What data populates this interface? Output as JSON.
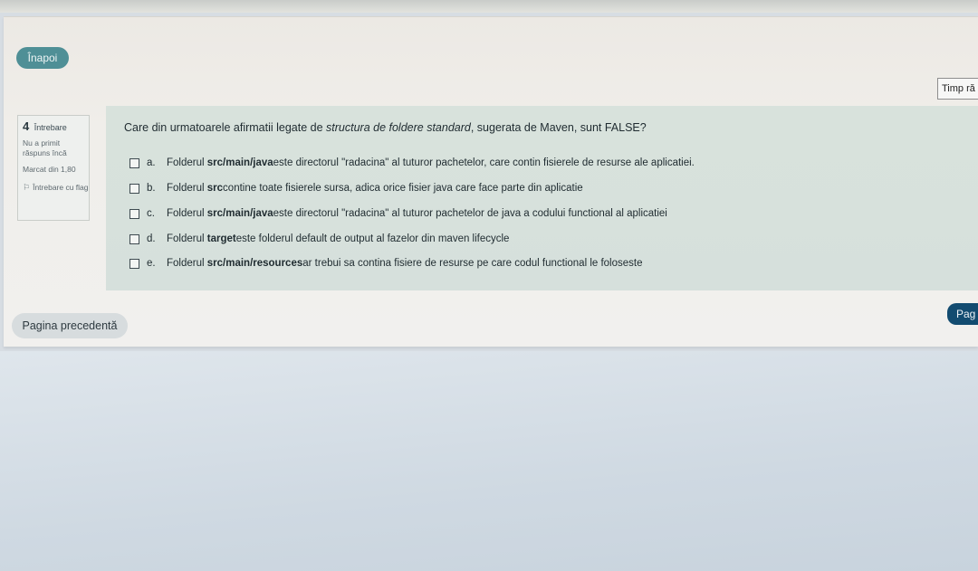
{
  "nav": {
    "back_label": "Înapoi",
    "timer_label": "Timp ră",
    "prev_label": "Pagina precedentă",
    "next_label": "Pag"
  },
  "question_info": {
    "number": "4",
    "label": "Întrebare",
    "status": "Nu a primit răspuns încă",
    "marks": "Marcat din 1,80",
    "flag_label": "Întrebare cu flag"
  },
  "question": {
    "text_pre": "Care din urmatoarele afirmatii legate de ",
    "text_emph": "structura de foldere standard",
    "text_post": ", sugerata de Maven, sunt FALSE?",
    "options": [
      {
        "letter": "a.",
        "pre": "Folderul ",
        "bold": "src/main/java",
        "post": " este directorul \"radacina\" al tuturor pachetelor, care contin fisierele de resurse ale aplicatiei."
      },
      {
        "letter": "b.",
        "pre": "Folderul ",
        "bold": "src",
        "post": " contine toate fisierele sursa, adica orice fisier java care face parte din aplicatie"
      },
      {
        "letter": "c.",
        "pre": "Folderul ",
        "bold": "src/main/java",
        "post": " este directorul \"radacina\" al tuturor pachetelor de java a codului functional al aplicatiei"
      },
      {
        "letter": "d.",
        "pre": "Folderul ",
        "bold": "target",
        "post": " este folderul default de output al fazelor din maven lifecycle"
      },
      {
        "letter": "e.",
        "pre": "Folderul ",
        "bold": "src/main/resources",
        "post": " ar trebui sa contina fisiere de resurse pe care codul functional le foloseste"
      }
    ]
  }
}
